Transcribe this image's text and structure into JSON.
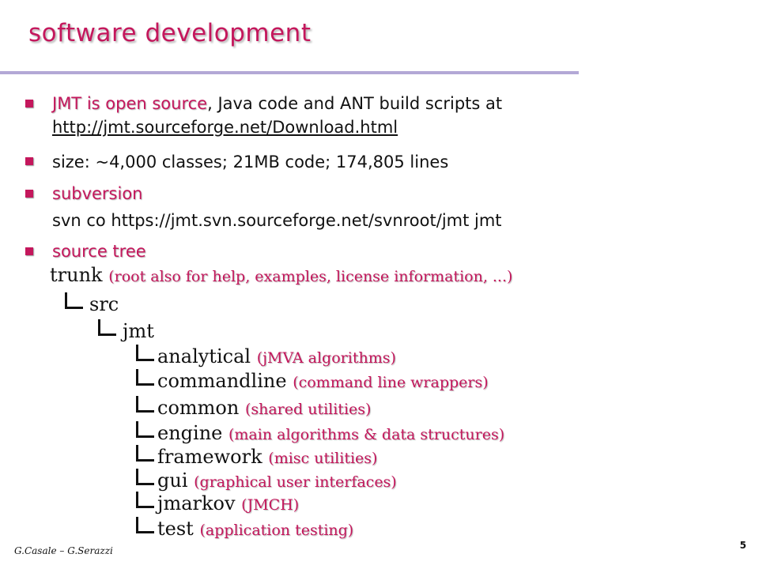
{
  "slide": {
    "title": "software development",
    "bullets": {
      "b1": {
        "highlight": "JMT is open source",
        "text": ", Java code and ANT build scripts at",
        "link": "http://jmt.sourceforge.net/Download.html"
      },
      "b2": {
        "text": "size: ~4,000 classes; 21MB code; 174,805 lines"
      },
      "b3": {
        "highlight": "subversion",
        "text": "svn co https://jmt.svn.sourceforge.net/svnroot/jmt jmt"
      },
      "b4": {
        "highlight": "source tree"
      }
    },
    "tree": {
      "root": {
        "name": "trunk",
        "note": "(root also for help, examples, license information, ...)"
      },
      "src": "src",
      "jmt": "jmt",
      "children": [
        {
          "name": "analytical",
          "note": "(jMVA algorithms)"
        },
        {
          "name": "commandline",
          "note": "(command line wrappers)"
        },
        {
          "name": "common",
          "note": "(shared utilities)"
        },
        {
          "name": "engine",
          "note": "(main algorithms & data structures)"
        },
        {
          "name": "framework",
          "note": "(misc utilities)"
        },
        {
          "name": "gui",
          "note": "(graphical user interfaces)"
        },
        {
          "name": "jmarkov",
          "note": "(JMCH)"
        },
        {
          "name": "test",
          "note": "(application testing)"
        }
      ]
    },
    "footer": "G.Casale – G.Serazzi",
    "page_number": "5",
    "colors": {
      "accent": "#c4175c",
      "rule": "#b3a8d6",
      "text": "#111111"
    }
  }
}
